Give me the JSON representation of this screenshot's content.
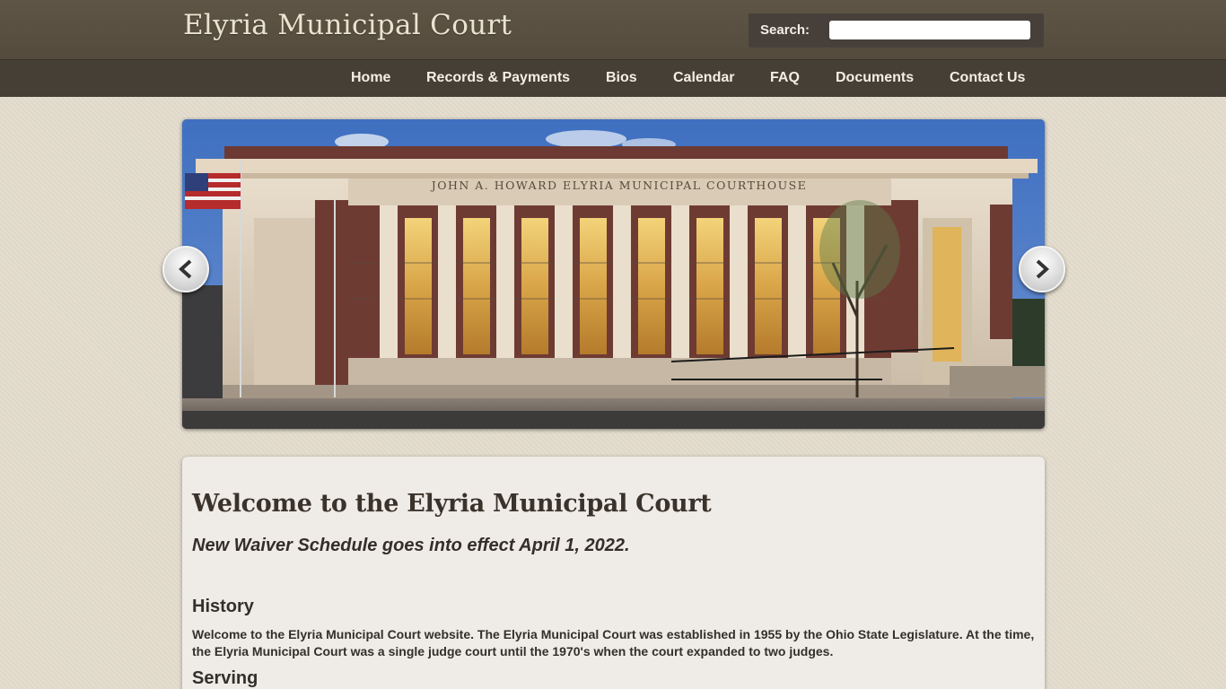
{
  "header": {
    "site_title": "Elyria Municipal Court",
    "search_label": "Search:",
    "search_value": ""
  },
  "nav": {
    "items": [
      {
        "label": "Home"
      },
      {
        "label": "Records & Payments"
      },
      {
        "label": "Bios"
      },
      {
        "label": "Calendar"
      },
      {
        "label": "FAQ"
      },
      {
        "label": "Documents"
      },
      {
        "label": "Contact Us"
      }
    ]
  },
  "slider": {
    "building_inscription": "JOHN A. HOWARD ELYRIA MUNICIPAL COURTHOUSE",
    "prev_icon": "chevron-left-icon",
    "next_icon": "chevron-right-icon"
  },
  "content": {
    "welcome_heading": "Welcome to the Elyria Municipal Court",
    "announcement": "New Waiver Schedule goes into effect April 1, 2022.",
    "history_heading": "History",
    "history_text": "Welcome to the Elyria Municipal Court website. The Elyria Municipal Court was established in 1955 by the Ohio State Legislature. At the time, the Elyria Municipal Court was a single judge court until the 1970's when the court expanded to two judges.",
    "serving_heading": "Serving"
  },
  "colors": {
    "header_bg": "#5a5043",
    "nav_bg": "#463f36",
    "page_bg": "#e3dccd",
    "content_bg": "#efebe6"
  }
}
